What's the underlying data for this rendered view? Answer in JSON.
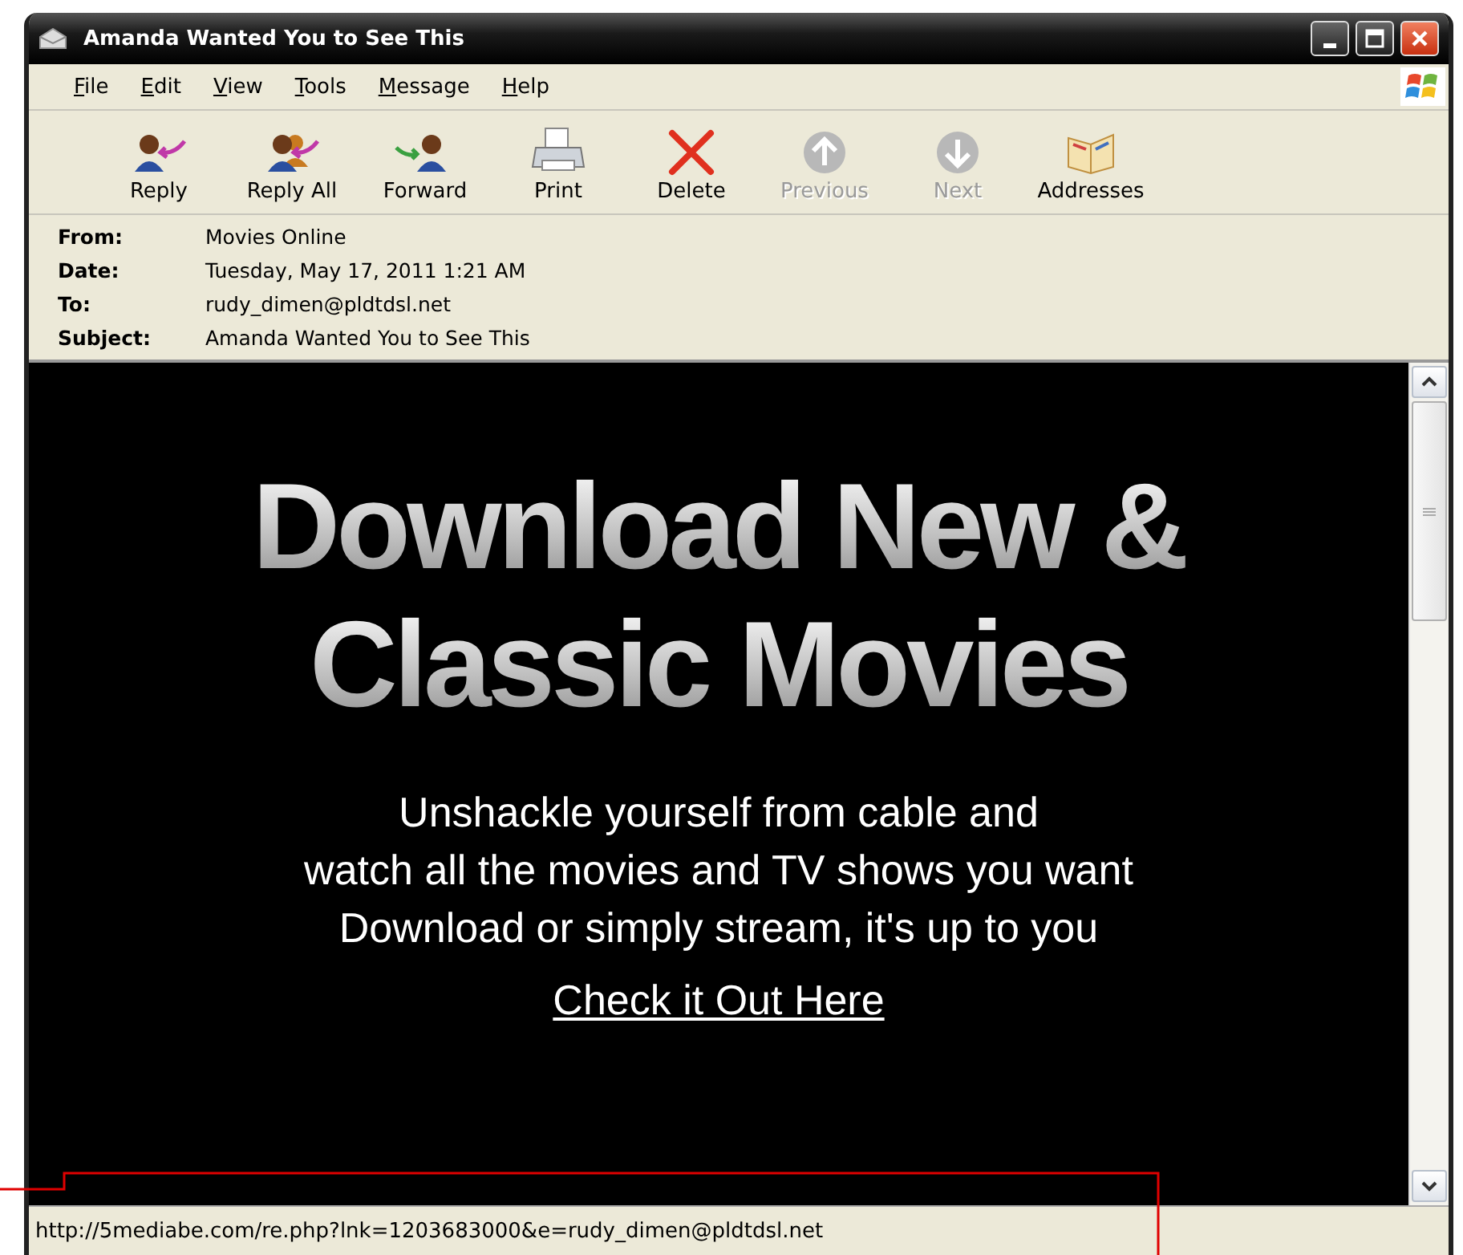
{
  "window": {
    "title": "Amanda Wanted You to See This"
  },
  "menu": [
    {
      "label": "File"
    },
    {
      "label": "Edit"
    },
    {
      "label": "View"
    },
    {
      "label": "Tools"
    },
    {
      "label": "Message"
    },
    {
      "label": "Help"
    }
  ],
  "toolbar": [
    {
      "kind": "reply",
      "label": "Reply",
      "disabled": false
    },
    {
      "kind": "reply_all",
      "label": "Reply All",
      "disabled": false
    },
    {
      "kind": "forward",
      "label": "Forward",
      "disabled": false
    },
    {
      "kind": "print",
      "label": "Print",
      "disabled": false
    },
    {
      "kind": "delete",
      "label": "Delete",
      "disabled": false
    },
    {
      "kind": "previous",
      "label": "Previous",
      "disabled": true
    },
    {
      "kind": "next",
      "label": "Next",
      "disabled": true
    },
    {
      "kind": "addresses",
      "label": "Addresses",
      "disabled": false
    }
  ],
  "header": [
    {
      "label": "From:",
      "value": "Movies Online"
    },
    {
      "label": "Date:",
      "value": "Tuesday, May 17, 2011 1:21 AM"
    },
    {
      "label": "To:",
      "value": "rudy_dimen@pldtdsl.net"
    },
    {
      "label": "Subject:",
      "value": "Amanda Wanted You to See This"
    }
  ],
  "message": {
    "headline": [
      "Download New &",
      "Classic Movies"
    ],
    "body": [
      "Unshackle yourself from cable and",
      "watch all the movies and TV shows you want",
      "Download or simply stream, it's up to you"
    ],
    "link": "Check it Out Here"
  },
  "status_bar": {
    "text": "http://5mediabe.com/re.php?lnk=1203683000&e=rudy_dimen@pldtdsl.net"
  }
}
